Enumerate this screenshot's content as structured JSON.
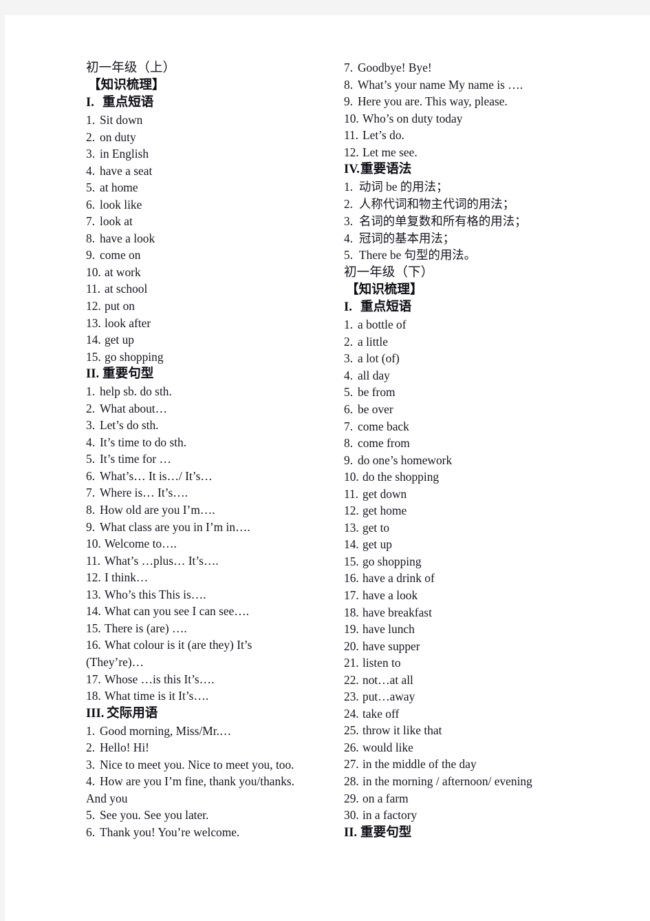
{
  "document": {
    "page_background": "#ffffff",
    "canvas_background": "#f4f4f4",
    "text_color": "#15161f"
  },
  "left_column": {
    "grade_title": "初一年级（上）",
    "knowledge_header": "【知识梳理】",
    "section_1": {
      "numeral": "I.",
      "title": "重点短语",
      "items": [
        {
          "n": "1.",
          "text": "Sit  down"
        },
        {
          "n": "2.",
          "text": "on  duty"
        },
        {
          "n": "3.",
          "text": "in  English"
        },
        {
          "n": "4.",
          "text": "have  a  seat"
        },
        {
          "n": "5.",
          "text": "at  home"
        },
        {
          "n": "6.",
          "text": "look  like"
        },
        {
          "n": "7.",
          "text": "look  at"
        },
        {
          "n": "8.",
          "text": "have  a  look"
        },
        {
          "n": "9.",
          "text": "come  on"
        },
        {
          "n": "10.",
          "text": "at  work"
        },
        {
          "n": "11.",
          "text": "at  school"
        },
        {
          "n": "12.",
          "text": "put  on"
        },
        {
          "n": "13.",
          "text": "look  after"
        },
        {
          "n": "14.",
          "text": "get  up"
        },
        {
          "n": "15.",
          "text": "go  shopping"
        }
      ]
    },
    "section_2": {
      "numeral": "II.",
      "title": "重要句型",
      "items": [
        {
          "n": "1.",
          "text": "help  sb.  do  sth."
        },
        {
          "n": "2.",
          "text": "What  about…"
        },
        {
          "n": "3.",
          "text": "Let’s  do  sth."
        },
        {
          "n": "4.",
          "text": "It’s  time  to  do  sth."
        },
        {
          "n": "5.",
          "text": "It’s  time  for  …"
        },
        {
          "n": "6.",
          "text": "What’s…  It  is…/  It’s…"
        },
        {
          "n": "7.",
          "text": "Where  is…  It’s…."
        },
        {
          "n": "8.",
          "text": "How  old  are  you  I’m…."
        },
        {
          "n": "9.",
          "text": "What  class  are  you  in  I’m  in…."
        },
        {
          "n": "10.",
          "text": "Welcome  to…."
        },
        {
          "n": "11.",
          "text": "What’s  …plus…  It’s…."
        },
        {
          "n": "12.",
          "text": "I  think…"
        },
        {
          "n": "13.",
          "text": "Who’s  this  This  is…."
        },
        {
          "n": "14.",
          "text": "What  can  you  see  I  can  see…."
        },
        {
          "n": "15.",
          "text": "There  is  (are)  …."
        },
        {
          "n": "16.",
          "text": "What  colour  is  it  (are  they)  It’s",
          "cont": "(They’re)…"
        },
        {
          "n": "17.",
          "text": "Whose  …is  this  It’s…."
        },
        {
          "n": "18.",
          "text": "What  time  is  it  It’s…."
        }
      ]
    },
    "section_3": {
      "numeral": "III.",
      "title": "交际用语",
      "items": [
        {
          "n": "1.",
          "text": "Good  morning,  Miss/Mr.…"
        },
        {
          "n": "2.",
          "text": "Hello!  Hi!"
        },
        {
          "n": "3.",
          "text": "Nice  to  meet  you.  Nice  to  meet  you,  too."
        },
        {
          "n": "4.",
          "text": "How  are  you  I’m  fine,  thank  you/thanks.",
          "cont": "And  you"
        },
        {
          "n": "5.",
          "text": "See  you.  See  you  later."
        },
        {
          "n": "6.",
          "text": "Thank  you!  You’re  welcome."
        }
      ]
    }
  },
  "right_column": {
    "section_3_continued": {
      "items": [
        {
          "n": "7.",
          "text": "Goodbye!  Bye!"
        },
        {
          "n": "8.",
          "text": "What’s  your  name  My  name  is  …."
        },
        {
          "n": "9.",
          "text": "Here  you  are.  This  way,  please."
        },
        {
          "n": "10.",
          "text": "Who’s  on  duty  today"
        },
        {
          "n": "11.",
          "text": "Let’s  do."
        },
        {
          "n": "12.",
          "text": "Let  me  see."
        }
      ]
    },
    "section_4": {
      "numeral": "IV.",
      "title": "重要语法",
      "items": [
        {
          "n": "1.",
          "text": "动词 be 的用法；"
        },
        {
          "n": "2.",
          "text": "人称代词和物主代词的用法；"
        },
        {
          "n": "3.",
          "text": "名词的单复数和所有格的用法；"
        },
        {
          "n": "4.",
          "text": "冠词的基本用法；"
        },
        {
          "n": "5.",
          "text": "There  be 句型的用法。"
        }
      ]
    },
    "grade_title": "初一年级（下）",
    "knowledge_header": "【知识梳理】",
    "section_1": {
      "numeral": "I.",
      "title": "重点短语",
      "items": [
        {
          "n": "1.",
          "text": "a  bottle  of"
        },
        {
          "n": "2.",
          "text": "a  little"
        },
        {
          "n": "3.",
          "text": "a  lot  (of)"
        },
        {
          "n": "4.",
          "text": "all  day"
        },
        {
          "n": "5.",
          "text": "be  from"
        },
        {
          "n": "6.",
          "text": "be  over"
        },
        {
          "n": "7.",
          "text": "come  back"
        },
        {
          "n": "8.",
          "text": "come  from"
        },
        {
          "n": "9.",
          "text": "do  one’s  homework"
        },
        {
          "n": "10.",
          "text": "do  the  shopping"
        },
        {
          "n": "11.",
          "text": "get  down"
        },
        {
          "n": "12.",
          "text": "get  home"
        },
        {
          "n": "13.",
          "text": "get  to"
        },
        {
          "n": "14.",
          "text": "get  up"
        },
        {
          "n": "15.",
          "text": "go  shopping"
        },
        {
          "n": "16.",
          "text": "have  a  drink  of"
        },
        {
          "n": "17.",
          "text": "have  a  look"
        },
        {
          "n": "18.",
          "text": "have  breakfast"
        },
        {
          "n": "19.",
          "text": "have  lunch"
        },
        {
          "n": "20.",
          "text": "have  supper"
        },
        {
          "n": "21.",
          "text": "listen  to"
        },
        {
          "n": "22.",
          "text": "not…at  all"
        },
        {
          "n": "23.",
          "text": "put…away"
        },
        {
          "n": "24.",
          "text": "take  off"
        },
        {
          "n": "25.",
          "text": "throw  it  like  that"
        },
        {
          "n": "26.",
          "text": "would  like"
        },
        {
          "n": "27.",
          "text": "in  the  middle  of  the  day"
        },
        {
          "n": "28.",
          "text": "in  the  morning  /  afternoon/  evening"
        },
        {
          "n": "29.",
          "text": "on  a  farm"
        },
        {
          "n": "30.",
          "text": "in  a  factory"
        }
      ]
    },
    "section_2": {
      "numeral": "II.",
      "title": "重要句型"
    }
  }
}
